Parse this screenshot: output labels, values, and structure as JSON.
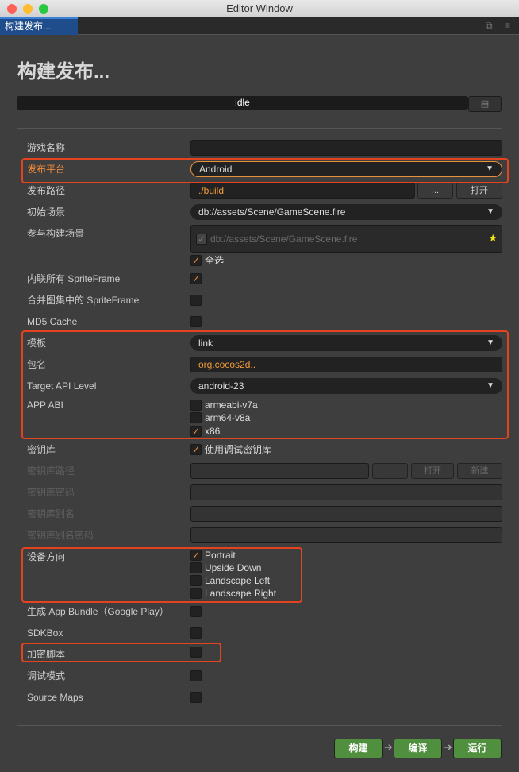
{
  "window": {
    "title": "Editor Window",
    "tab": "构建发布..."
  },
  "header": {
    "title": "构建发布...",
    "status": "idle",
    "log_icon": "log-file-icon"
  },
  "form": {
    "game_name": {
      "label": "游戏名称",
      "value": ""
    },
    "platform": {
      "label": "发布平台",
      "value": "Android"
    },
    "build_path": {
      "label": "发布路径",
      "value": "./build",
      "browse": "...",
      "open": "打开"
    },
    "start_scene": {
      "label": "初始场景",
      "value": "db://assets/Scene/GameScene.fire"
    },
    "included_scenes": {
      "label": "参与构建场景",
      "scene": "db://assets/Scene/GameScene.fire",
      "select_all": "全选"
    },
    "inline_spriteframe": {
      "label": "内联所有 SpriteFrame",
      "checked": true
    },
    "merge_spriteframe": {
      "label": "合并图集中的 SpriteFrame",
      "checked": false
    },
    "md5": {
      "label": "MD5 Cache",
      "checked": false
    },
    "template": {
      "label": "模板",
      "value": "link"
    },
    "package": {
      "label": "包名",
      "value": "org.cocos2d.."
    },
    "api_level": {
      "label": "Target API Level",
      "value": "android-23"
    },
    "abi": {
      "label": "APP ABI",
      "options": [
        {
          "label": "armeabi-v7a",
          "checked": false
        },
        {
          "label": "arm64-v8a",
          "checked": false
        },
        {
          "label": "x86",
          "checked": true
        }
      ]
    },
    "keystore": {
      "label": "密钥库",
      "debug_label": "使用调试密钥库",
      "checked": true
    },
    "keystore_path": {
      "label": "密钥库路径",
      "browse": "...",
      "open": "打开",
      "new": "新建"
    },
    "keystore_password": {
      "label": "密钥库密码"
    },
    "keystore_alias": {
      "label": "密钥库别名"
    },
    "keystore_alias_password": {
      "label": "密钥库别名密码"
    },
    "orientation": {
      "label": "设备方向",
      "options": [
        {
          "label": "Portrait",
          "checked": true
        },
        {
          "label": "Upside Down",
          "checked": false
        },
        {
          "label": "Landscape Left",
          "checked": false
        },
        {
          "label": "Landscape Right",
          "checked": false
        }
      ]
    },
    "app_bundle": {
      "label": "生成 App Bundle（Google Play）",
      "checked": false
    },
    "sdkbox": {
      "label": "SDKBox",
      "checked": false
    },
    "encrypt": {
      "label": "加密脚本",
      "checked": false
    },
    "debug": {
      "label": "调试模式",
      "checked": false
    },
    "source_maps": {
      "label": "Source Maps",
      "checked": false
    }
  },
  "footer": {
    "build": "构建",
    "compile": "编译",
    "run": "运行"
  },
  "colors": {
    "accent": "#f08a3a",
    "highlight": "#e3431f",
    "green": "#4f8f3e"
  }
}
